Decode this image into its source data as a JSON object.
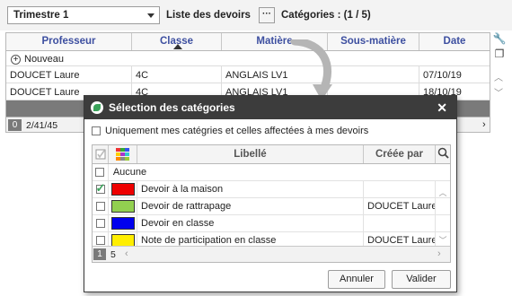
{
  "toolbar": {
    "period": "Trimestre 1",
    "list_label": "Liste des devoirs",
    "dots_label": "···",
    "categories_label": "Catégories : (1 / 5)"
  },
  "grid": {
    "columns": [
      "Professeur",
      "Classe",
      "Matière",
      "Sous-matière",
      "Date"
    ],
    "add_label": "Nouveau",
    "rows": [
      {
        "prof": "DOUCET Laure",
        "classe": "4C",
        "matiere": "ANGLAIS LV1",
        "sous": "",
        "date": "07/10/19"
      },
      {
        "prof": "DOUCET Laure",
        "classe": "4C",
        "matiere": "ANGLAIS LV1",
        "sous": "",
        "date": "18/10/19"
      }
    ],
    "footer_count": "0",
    "footer_text": "2/41/45"
  },
  "dialog": {
    "title": "Sélection des catégories",
    "close": "✕",
    "only_mine_label": "Uniquement mes catégries et celles affectées à mes devoirs",
    "headers": {
      "libelle": "Libellé",
      "creee_par": "Créée par"
    },
    "none_label": "Aucune",
    "categories": [
      {
        "label": "Devoir à la maison",
        "by": "",
        "color": "#ee0000",
        "checked": true
      },
      {
        "label": "Devoir de rattrapage",
        "by": "DOUCET Laure",
        "color": "#92d050",
        "checked": false
      },
      {
        "label": "Devoir en classe",
        "by": "",
        "color": "#0000ee",
        "checked": false
      },
      {
        "label": "Note de participation en classe",
        "by": "DOUCET Laure",
        "color": "#ffee00",
        "checked": false
      }
    ],
    "footer_page": "1",
    "footer_total": "5",
    "cancel_label": "Annuler",
    "ok_label": "Valider"
  }
}
